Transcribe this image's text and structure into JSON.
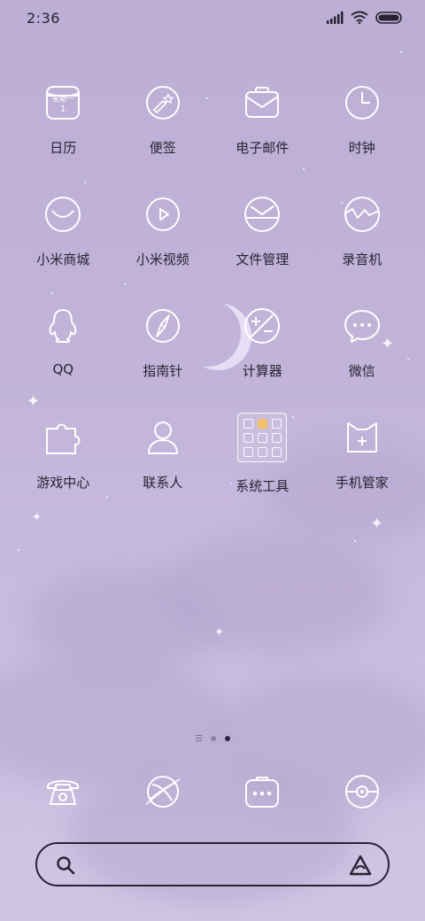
{
  "status_bar": {
    "time": "2:36"
  },
  "apps": [
    {
      "label": "日历",
      "icon": "calendar-icon",
      "badge_text": "星期一",
      "day": "1"
    },
    {
      "label": "便签",
      "icon": "notes-icon"
    },
    {
      "label": "电子邮件",
      "icon": "mail-icon"
    },
    {
      "label": "时钟",
      "icon": "clock-icon"
    },
    {
      "label": "小米商城",
      "icon": "store-smile-icon"
    },
    {
      "label": "小米视频",
      "icon": "video-play-icon"
    },
    {
      "label": "文件管理",
      "icon": "file-manager-icon"
    },
    {
      "label": "录音机",
      "icon": "recorder-wave-icon"
    },
    {
      "label": "QQ",
      "icon": "qq-penguin-icon"
    },
    {
      "label": "指南针",
      "icon": "compass-icon"
    },
    {
      "label": "计算器",
      "icon": "calculator-icon"
    },
    {
      "label": "微信",
      "icon": "wechat-bubble-icon"
    },
    {
      "label": "游戏中心",
      "icon": "puzzle-icon"
    },
    {
      "label": "联系人",
      "icon": "contacts-person-icon"
    },
    {
      "label": "系统工具",
      "icon": "folder-icon"
    },
    {
      "label": "手机管家",
      "icon": "security-shield-icon"
    }
  ],
  "page_indicator": {
    "pages": 2,
    "active": 2
  },
  "dock": [
    {
      "icon": "phone-icon"
    },
    {
      "icon": "browser-planet-icon"
    },
    {
      "icon": "messages-icon"
    },
    {
      "icon": "camera-icon"
    }
  ],
  "search": {
    "placeholder": ""
  },
  "colors": {
    "wallpaper": "#c2b4d9",
    "text": "#2a2233",
    "icon_stroke": "#ffffff"
  }
}
